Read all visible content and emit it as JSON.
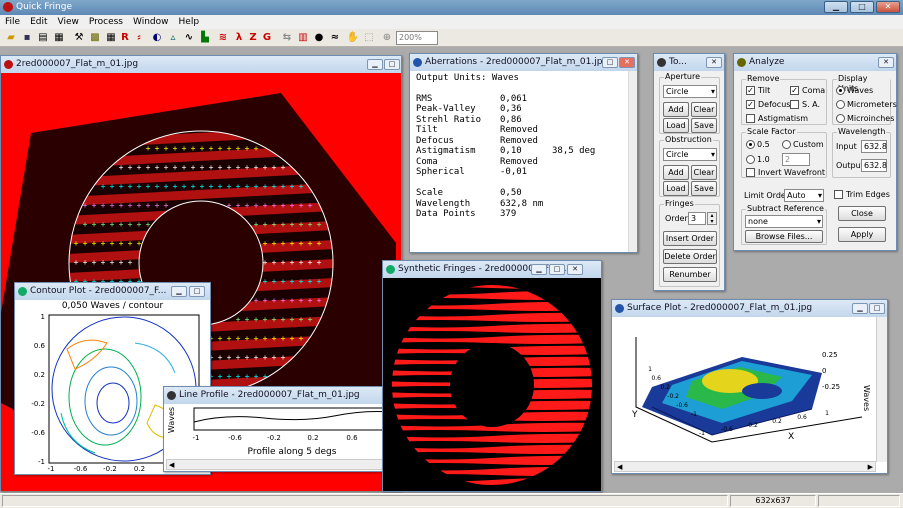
{
  "app": {
    "title": "Quick Fringe"
  },
  "menu": [
    "File",
    "Edit",
    "View",
    "Process",
    "Window",
    "Help"
  ],
  "toolbar": {
    "zoom": "200%"
  },
  "status": {
    "size": "632x637"
  },
  "image_window": {
    "title": "2red000007_Flat_m_01.jpg"
  },
  "aberrations": {
    "title": "Aberrations - 2red000007_Flat_m_01.jpg",
    "units_line": "Output Units: Waves",
    "rows": [
      {
        "label": "RMS",
        "value": "0,061",
        "extra": ""
      },
      {
        "label": "Peak-Valley",
        "value": "0,36",
        "extra": ""
      },
      {
        "label": "Strehl Ratio",
        "value": "0,86",
        "extra": ""
      },
      {
        "label": "Tilt",
        "value": "Removed",
        "extra": ""
      },
      {
        "label": "Defocus",
        "value": "Removed",
        "extra": ""
      },
      {
        "label": "Astigmatism",
        "value": "0,10",
        "extra": "38,5 deg"
      },
      {
        "label": "Coma",
        "value": "Removed",
        "extra": ""
      },
      {
        "label": "Spherical",
        "value": "-0,01",
        "extra": ""
      },
      {
        "label": "",
        "value": "",
        "extra": ""
      },
      {
        "label": "Scale",
        "value": "0,50",
        "extra": ""
      },
      {
        "label": "Wavelength",
        "value": "632,8 nm",
        "extra": ""
      },
      {
        "label": "Data Points",
        "value": "379",
        "extra": ""
      }
    ]
  },
  "tools": {
    "title": "To...",
    "aperture_label": "Aperture",
    "aperture_value": "Circle",
    "obstruction_label": "Obstruction",
    "obstruction_value": "Circle",
    "add": "Add",
    "clear": "Clear",
    "load": "Load",
    "save": "Save",
    "fringes_label": "Fringes",
    "order_label": "Order",
    "order_value": "3",
    "insert_order": "Insert Order",
    "delete_order": "Delete Order",
    "renumber": "Renumber"
  },
  "analyze": {
    "title": "Analyze",
    "remove_label": "Remove",
    "tilt": "Tilt",
    "coma": "Coma",
    "defocus": "Defocus",
    "sa": "S. A.",
    "astig": "Astigmatism",
    "display_units_label": "Display Units",
    "units": [
      "Waves",
      "Micrometers",
      "Microinches"
    ],
    "scale_label": "Scale Factor",
    "scale_05": "0.5",
    "scale_custom": "Custom",
    "scale_10": "1.0",
    "scale_custom_value": "2",
    "invert": "Invert Wavefront",
    "wavelength_label": "Wavelength",
    "input_label": "Input",
    "input_value": "632.8",
    "output_label": "Output",
    "output_value": "632.8",
    "limit_order_label": "Limit Order",
    "limit_order_value": "Auto",
    "trim_edges": "Trim Edges",
    "subtract_ref_label": "Subtract Reference",
    "subtract_ref_value": "none",
    "browse": "Browse Files...",
    "close": "Close",
    "apply": "Apply"
  },
  "contour": {
    "title": "Contour Plot - 2red000007_F...",
    "subtitle": "0,050 Waves / contour",
    "yticks": [
      "1",
      "0.6",
      "0.2",
      "-0.2",
      "-0.6",
      "-1"
    ],
    "xticks": [
      "-1",
      "-0.6",
      "-0.2",
      "0.2",
      "0.6",
      "1"
    ]
  },
  "line_profile": {
    "title": "Line Profile - 2red000007_Flat_m_01.jpg",
    "ylabel": "Waves",
    "xticks": [
      "-1",
      "-0.6",
      "-0.2",
      "0.2",
      "0.6",
      "1"
    ],
    "caption": "Profile along 5 degs"
  },
  "synthetic": {
    "title": "Synthetic Fringes - 2red000007_Flat..."
  },
  "surface": {
    "title": "Surface Plot - 2red000007_Flat_m_01.jpg",
    "zticks": [
      "0.25",
      "0",
      "-0.25"
    ],
    "zlabel": "Waves",
    "y_ticks": [
      "1",
      "0.6",
      "0.2",
      "-0.2",
      "-0.6",
      "-1"
    ],
    "x_ticks": [
      "-1",
      "-0.6",
      "-0.2",
      "0.2",
      "0.6",
      "1"
    ],
    "x_label": "X",
    "y_label": "Y"
  },
  "colors": {
    "fringe_red": "#ff1a1a",
    "background_red": "#ff0000",
    "title_blue": "#5e88b5"
  }
}
